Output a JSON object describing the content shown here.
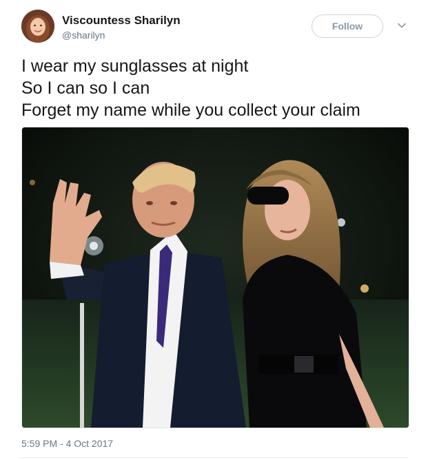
{
  "user": {
    "display_name": "Viscountess Sharilyn",
    "handle": "@sharilyn",
    "follow_label": "Follow",
    "avatar_icon": "profile-photo",
    "menu_icon": "chevron-down-icon"
  },
  "tweet": {
    "lines": [
      "I wear my sunglasses at night",
      "So I can so I can",
      "Forget my name while you collect your claim"
    ],
    "timestamp": "5:59 PM - 4 Oct 2017"
  },
  "colors": {
    "text_primary": "#14171a",
    "text_secondary": "#657786",
    "follow_border": "#c9d3db",
    "divider": "#e6ecf0"
  }
}
